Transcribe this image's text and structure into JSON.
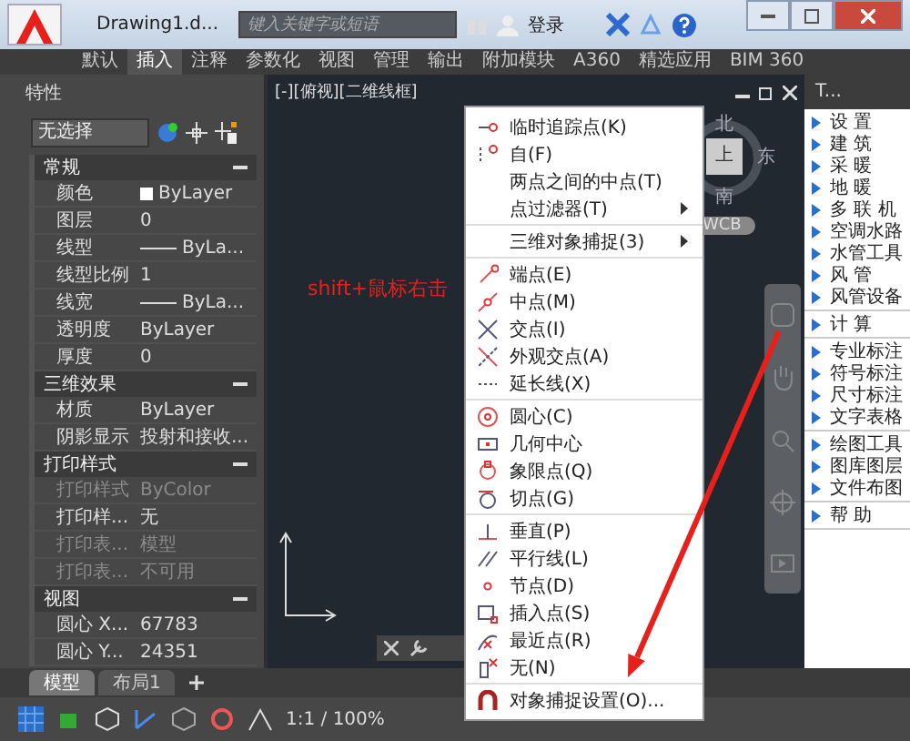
{
  "title_bar": {
    "document_tab": "Drawing1.d...",
    "search": {
      "placeholder": "键入关键字或短语"
    },
    "sign_in": "登录"
  },
  "ribbon_tabs": [
    {
      "label": "默认",
      "selected": false
    },
    {
      "label": "插入",
      "selected": true
    },
    {
      "label": "注释",
      "selected": false
    },
    {
      "label": "参数化",
      "selected": false
    },
    {
      "label": "视图",
      "selected": false
    },
    {
      "label": "管理",
      "selected": false
    },
    {
      "label": "输出",
      "selected": false
    },
    {
      "label": "附加模块",
      "selected": false
    },
    {
      "label": "A360",
      "selected": false
    },
    {
      "label": "精选应用",
      "selected": false
    },
    {
      "label": "BIM 360",
      "selected": false
    }
  ],
  "properties": {
    "title": "特性",
    "selection": "无选择",
    "sections": [
      {
        "title": "常规",
        "rows": [
          {
            "name": "颜色",
            "value": "ByLayer",
            "kind": "swatch",
            "disabled": false
          },
          {
            "name": "图层",
            "value": "0",
            "kind": "text",
            "disabled": false
          },
          {
            "name": "线型",
            "value": "ByLa...",
            "kind": "line",
            "disabled": false
          },
          {
            "name": "线型比例",
            "value": "1",
            "kind": "text",
            "disabled": false
          },
          {
            "name": "线宽",
            "value": "ByLa...",
            "kind": "line",
            "disabled": false
          },
          {
            "name": "透明度",
            "value": "ByLayer",
            "kind": "text",
            "disabled": false
          },
          {
            "name": "厚度",
            "value": "0",
            "kind": "text",
            "disabled": false
          }
        ]
      },
      {
        "title": "三维效果",
        "rows": [
          {
            "name": "材质",
            "value": "ByLayer",
            "kind": "text",
            "disabled": false
          },
          {
            "name": "阴影显示",
            "value": "投射和接收...",
            "kind": "text",
            "disabled": false
          }
        ]
      },
      {
        "title": "打印样式",
        "rows": [
          {
            "name": "打印样式",
            "value": "ByColor",
            "kind": "text",
            "disabled": true
          },
          {
            "name": "打印样...",
            "value": "无",
            "kind": "text",
            "disabled": false
          },
          {
            "name": "打印表...",
            "value": "模型",
            "kind": "text",
            "disabled": true
          },
          {
            "name": "打印表...",
            "value": "不可用",
            "kind": "text",
            "disabled": true
          }
        ]
      },
      {
        "title": "视图",
        "rows": [
          {
            "name": "圆心 X...",
            "value": "67783",
            "kind": "text",
            "disabled": false
          },
          {
            "name": "圆心 Y...",
            "value": "24351",
            "kind": "text",
            "disabled": false
          }
        ]
      }
    ]
  },
  "viewport": {
    "label": "[-][俯视][二维线框]",
    "viewcube": {
      "top": "上",
      "north": "北",
      "east": "东",
      "south": "南",
      "wcs": "WCB"
    }
  },
  "annotation": "shift+鼠标右击",
  "context_menu": {
    "groups": [
      {
        "items": [
          {
            "label": "临时追踪点(K)",
            "submenu": false
          },
          {
            "label": "自(F)",
            "submenu": false
          },
          {
            "label": "两点之间的中点(T)",
            "submenu": false
          },
          {
            "label": "点过滤器(T)",
            "submenu": true
          }
        ]
      },
      {
        "items": [
          {
            "label": "三维对象捕捉(3)",
            "submenu": true
          }
        ]
      },
      {
        "items": [
          {
            "label": "端点(E)",
            "submenu": false
          },
          {
            "label": "中点(M)",
            "submenu": false
          },
          {
            "label": "交点(I)",
            "submenu": false
          },
          {
            "label": "外观交点(A)",
            "submenu": false
          },
          {
            "label": "延长线(X)",
            "submenu": false
          }
        ]
      },
      {
        "items": [
          {
            "label": "圆心(C)",
            "submenu": false
          },
          {
            "label": "几何中心",
            "submenu": false
          },
          {
            "label": "象限点(Q)",
            "submenu": false
          },
          {
            "label": "切点(G)",
            "submenu": false
          }
        ]
      },
      {
        "items": [
          {
            "label": "垂直(P)",
            "submenu": false
          },
          {
            "label": "平行线(L)",
            "submenu": false
          },
          {
            "label": "节点(D)",
            "submenu": false
          },
          {
            "label": "插入点(S)",
            "submenu": false
          },
          {
            "label": "最近点(R)",
            "submenu": false
          },
          {
            "label": "无(N)",
            "submenu": false
          }
        ]
      },
      {
        "items": [
          {
            "label": "对象捕捉设置(O)...",
            "submenu": false
          }
        ]
      }
    ]
  },
  "tool_palette": {
    "title": "T...",
    "groups": [
      {
        "items": [
          "设 置",
          "建 筑",
          "采 暖",
          "地 暖",
          "多 联 机",
          "空调水路",
          "水管工具",
          "风 管",
          "风管设备"
        ]
      },
      {
        "items": [
          "计 算"
        ]
      },
      {
        "items": [
          "专业标注",
          "符号标注",
          "尺寸标注",
          "文字表格"
        ]
      },
      {
        "items": [
          "绘图工具",
          "图库图层",
          "文件布图"
        ]
      },
      {
        "items": [
          "帮 助"
        ]
      }
    ]
  },
  "layout_tabs": [
    {
      "label": "模型",
      "selected": true
    },
    {
      "label": "布局1",
      "selected": false
    }
  ],
  "status_bar": {
    "scale": "1:1 / 100%"
  }
}
